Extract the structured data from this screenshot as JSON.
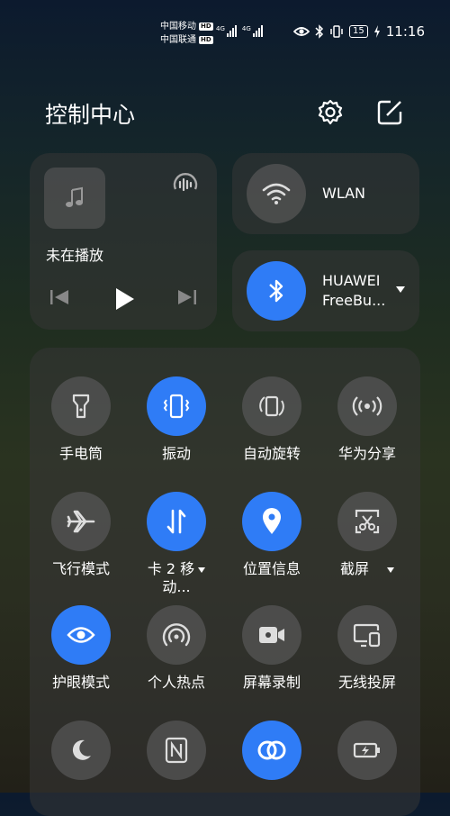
{
  "status_bar": {
    "carrier1": "中国移动",
    "carrier2": "中国联通",
    "hd_badge": "HD",
    "net1": "4G",
    "net2": "4G",
    "battery": "15",
    "time": "11:16"
  },
  "header": {
    "title": "控制中心",
    "settings_icon": "gear-icon",
    "edit_icon": "edit-icon"
  },
  "media": {
    "status": "未在播放",
    "icons": [
      "music-note-icon",
      "audio-cast-icon",
      "previous-icon",
      "play-icon",
      "next-icon"
    ]
  },
  "tiles": {
    "wlan_label": "WLAN",
    "bt_label_line1": "HUAWEI",
    "bt_label_line2": "FreeBu..."
  },
  "toggles": [
    {
      "label": "手电筒",
      "active": false,
      "icon": "flashlight-icon"
    },
    {
      "label": "振动",
      "active": true,
      "icon": "vibrate-icon"
    },
    {
      "label": "自动旋转",
      "active": false,
      "icon": "auto-rotate-icon"
    },
    {
      "label": "华为分享",
      "active": false,
      "icon": "share-icon"
    },
    {
      "label": "飞行模式",
      "active": false,
      "icon": "airplane-icon"
    },
    {
      "label": "卡 2 移",
      "label2": "动...",
      "active": true,
      "icon": "mobile-data-icon"
    },
    {
      "label": "位置信息",
      "active": true,
      "icon": "location-icon"
    },
    {
      "label": "截屏",
      "active": false,
      "icon": "screenshot-icon"
    },
    {
      "label": "护眼模式",
      "active": true,
      "icon": "eye-icon"
    },
    {
      "label": "个人热点",
      "active": false,
      "icon": "hotspot-icon"
    },
    {
      "label": "屏幕录制",
      "active": false,
      "icon": "screen-record-icon"
    },
    {
      "label": "无线投屏",
      "active": false,
      "icon": "wireless-projection-icon"
    },
    {
      "label": "",
      "active": false,
      "icon": "moon-icon"
    },
    {
      "label": "",
      "active": false,
      "icon": "nfc-icon"
    },
    {
      "label": "",
      "active": true,
      "icon": "data-saver-icon"
    },
    {
      "label": "",
      "active": false,
      "icon": "power-saving-icon"
    }
  ],
  "colors": {
    "accent": "#2f7cf6",
    "tile_off": "#555555"
  }
}
